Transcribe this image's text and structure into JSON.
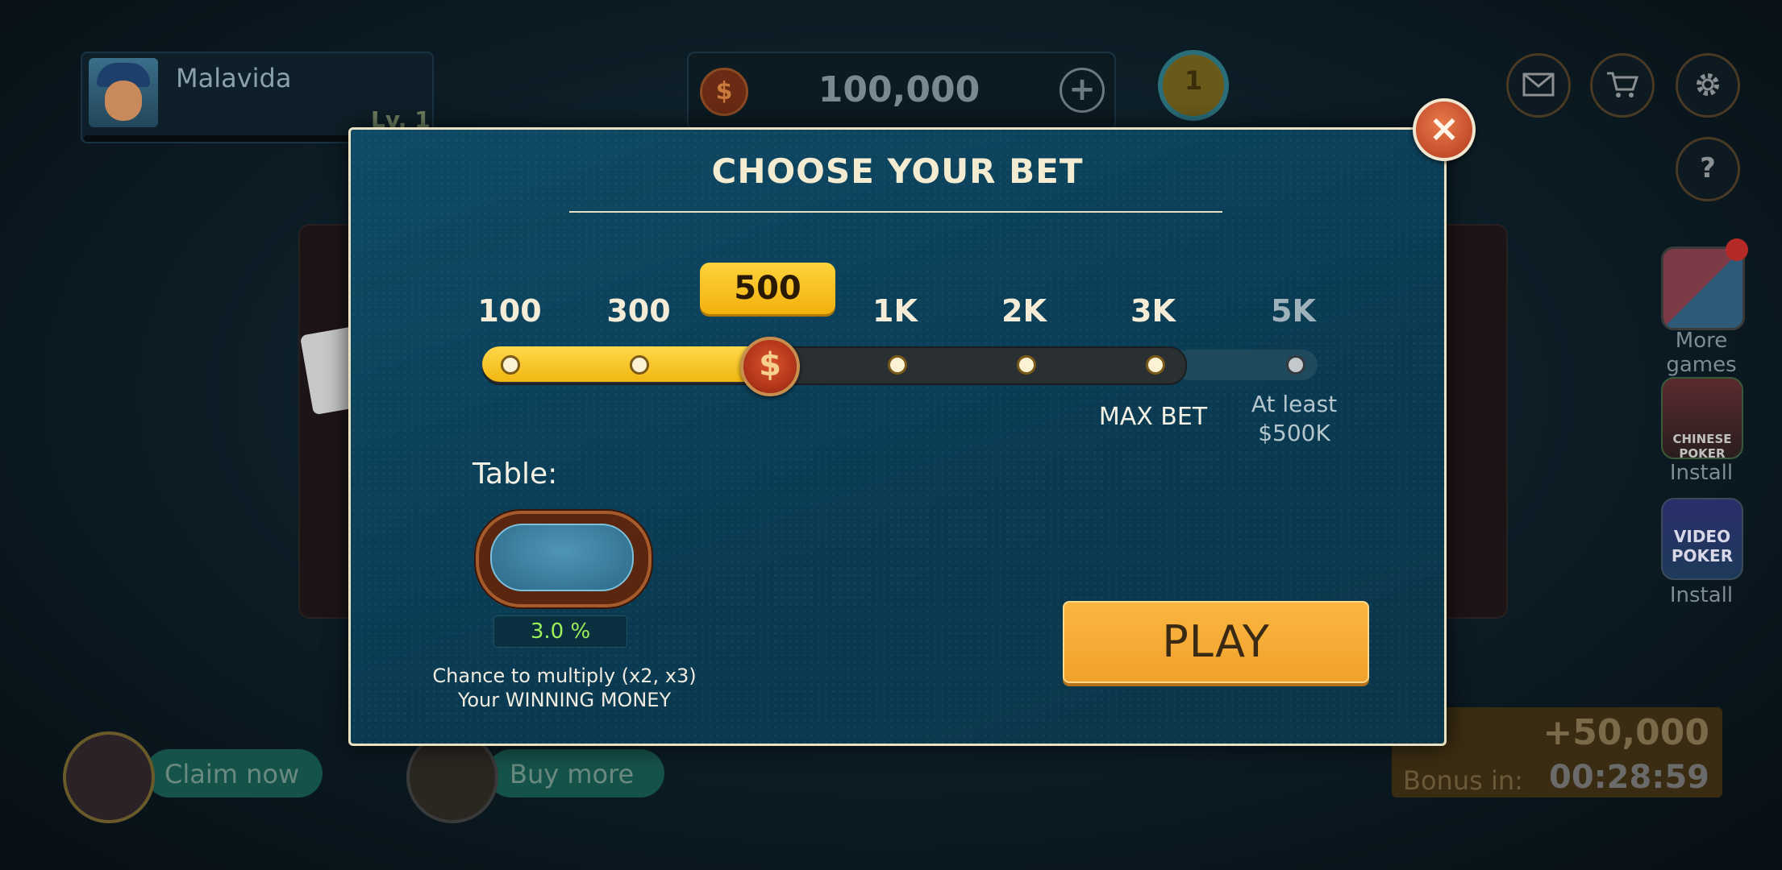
{
  "header": {
    "player_name": "Malavida",
    "level": "Lv. 1",
    "coin_balance": "100,000",
    "coin_plus": "+",
    "rank": "1",
    "mail_icon": "mail-icon",
    "cart_icon": "cart-icon",
    "settings_icon": "gear-icon",
    "help": "?"
  },
  "side_apps": [
    {
      "label": "More games"
    },
    {
      "label": "Install",
      "art": "CHINESE POKER"
    },
    {
      "label": "Install",
      "art": "VIDEO POKER"
    }
  ],
  "bottom": {
    "claim_label": "Claim now",
    "buy_label": "Buy more",
    "bonus_amount": "+50,000",
    "bonus_label": "Bonus in:",
    "bonus_timer": "00:28:59"
  },
  "modal": {
    "title": "CHOOSE YOUR BET",
    "close": "×",
    "selected_bet": "500",
    "selected_index": 2,
    "bets": [
      "100",
      "300",
      "500",
      "1K",
      "2K",
      "3K",
      "5K"
    ],
    "max_bet_label": "MAX BET",
    "locked_line1": "At least",
    "locked_line2": "$500K",
    "thumb_symbol": "$",
    "table_label": "Table:",
    "table_percent": "3.0 %",
    "chance_line1": "Chance to multiply (x2, x3)",
    "chance_line2": "Your WINNING MONEY",
    "play_label": "PLAY"
  },
  "colors": {
    "accent_yellow": "#f7c21e",
    "play_orange": "#f4a835",
    "modal_blue": "#0d4560",
    "percent_green": "#9cf05a"
  }
}
